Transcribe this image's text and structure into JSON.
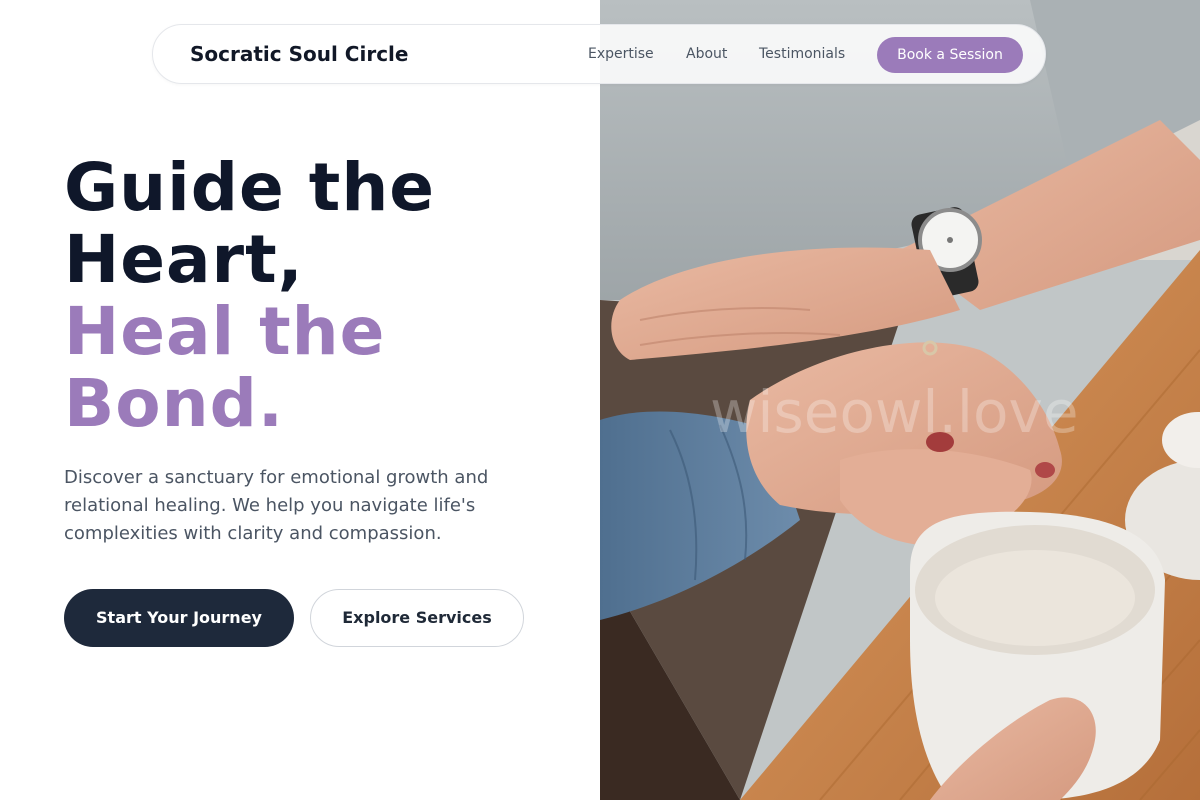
{
  "brand": {
    "name": "Socratic Soul Circle"
  },
  "nav": {
    "links": [
      "Expertise",
      "About",
      "Testimonials"
    ],
    "cta_label": "Book a Session"
  },
  "hero": {
    "headline_line1": "Guide the",
    "headline_line2": "Heart,",
    "headline_line3": "Heal the",
    "headline_line4": "Bond.",
    "description": "Discover a sanctuary for emotional growth and relational healing. We help you navigate life's complexities with clarity and compassion.",
    "primary_button": "Start Your Journey",
    "secondary_button": "Explore Services"
  },
  "image": {
    "watermark": "wiseowl.love"
  },
  "colors": {
    "accent": "#9b7bba",
    "dark": "#0f172a",
    "button_dark": "#1e293b"
  }
}
